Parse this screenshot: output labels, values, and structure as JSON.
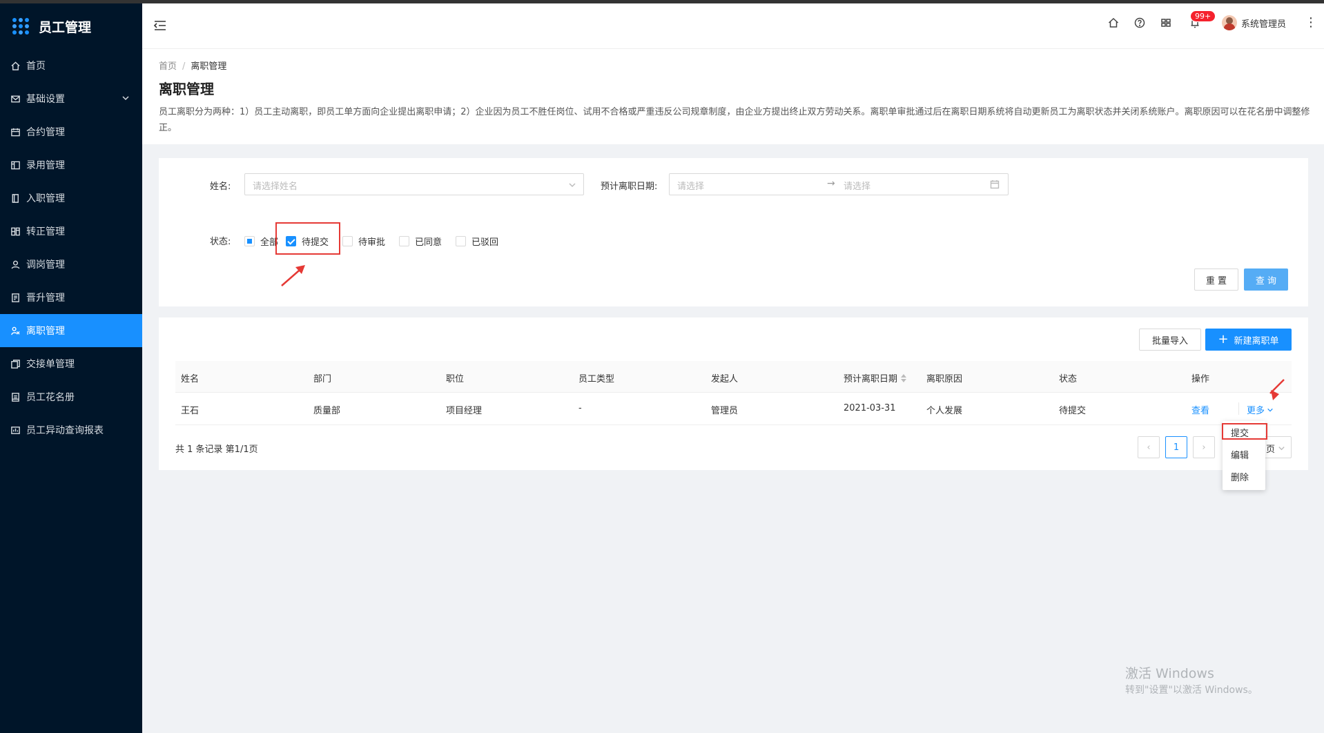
{
  "app": {
    "title": "员工管理"
  },
  "sidebar": {
    "items": [
      {
        "label": "首页",
        "icon": "home-icon"
      },
      {
        "label": "基础设置",
        "icon": "mail-icon"
      },
      {
        "label": "合约管理",
        "icon": "calendar-icon"
      },
      {
        "label": "录用管理",
        "icon": "layout-icon"
      },
      {
        "label": "入职管理",
        "icon": "book-icon"
      },
      {
        "label": "转正管理",
        "icon": "switch-icon"
      },
      {
        "label": "调岗管理",
        "icon": "user-icon"
      },
      {
        "label": "晋升管理",
        "icon": "file-icon"
      },
      {
        "label": "离职管理",
        "icon": "leave-icon",
        "active": true
      },
      {
        "label": "交接单管理",
        "icon": "copy-icon"
      },
      {
        "label": "员工花名册",
        "icon": "roster-icon"
      },
      {
        "label": "员工异动查询报表",
        "icon": "report-icon"
      }
    ]
  },
  "header": {
    "notification_badge": "99+",
    "username": "系统管理员",
    "icons": [
      "home-icon",
      "help-icon",
      "grid-icon",
      "bell-icon",
      "more-icon"
    ]
  },
  "page": {
    "breadcrumb": [
      "首页",
      "离职管理"
    ],
    "breadcrumb_sep": "/",
    "title": "离职管理",
    "description": "员工离职分为两种：1）员工主动离职，即员工单方面向企业提出离职申请；2）企业因为员工不胜任岗位、试用不合格或严重违反公司规章制度，由企业方提出终止双方劳动关系。离职单审批通过后在离职日期系统将自动更新员工为离职状态并关闭系统账户。离职原因可以在花名册中调整修正。"
  },
  "filter": {
    "name_label": "姓名:",
    "name_placeholder": "请选择姓名",
    "date_label": "预计离职日期:",
    "date_start_placeholder": "请选择",
    "date_end_placeholder": "请选择",
    "date_arrow": "→",
    "status_label": "状态:",
    "statuses": [
      {
        "label": "全部",
        "state": "indeterminate"
      },
      {
        "label": "待提交",
        "state": "checked"
      },
      {
        "label": "待审批",
        "state": "unchecked"
      },
      {
        "label": "已同意",
        "state": "unchecked"
      },
      {
        "label": "已驳回",
        "state": "unchecked"
      }
    ],
    "reset_label": "重 置",
    "query_label": "查 询"
  },
  "table": {
    "import_label": "批量导入",
    "new_label": "新建离职单",
    "new_icon": "+",
    "columns": [
      "姓名",
      "部门",
      "职位",
      "员工类型",
      "发起人",
      "预计离职日期",
      "离职原因",
      "状态",
      "操作"
    ],
    "rows": [
      {
        "name": "王石",
        "dept": "质量部",
        "position": "项目经理",
        "type": "-",
        "initiator": "管理员",
        "date": "2021-03-31",
        "reason": "个人发展",
        "status": "待提交",
        "view": "查看",
        "more": "更多"
      }
    ],
    "total": "共 1 条记录 第1/1页",
    "current_page": "1",
    "page_size_partial": "页"
  },
  "dropdown": {
    "items": [
      "提交",
      "编辑",
      "删除"
    ]
  },
  "watermark": {
    "line1": "激活 Windows",
    "line2": "转到\"设置\"以激活 Windows。"
  },
  "colors": {
    "primary": "#1890ff",
    "sidebar": "#001529",
    "annotation": "#e53935",
    "badge": "#f5222d"
  }
}
